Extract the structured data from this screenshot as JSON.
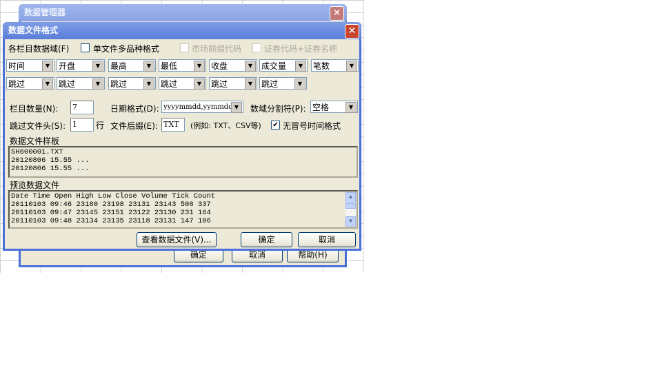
{
  "back_dialog": {
    "title": "数据管理器",
    "ok": "确定",
    "cancel": "取消",
    "help": "帮助(H)",
    "close": "✕"
  },
  "dialog": {
    "title": "数据文件格式",
    "close": "✕",
    "fields_label": "各栏目数据域(F)",
    "multi_label": "单文件多品种格式",
    "market_prefix_label": "市场前缀代码",
    "code_name_label": "证券代码+证券名称",
    "columns_row1": [
      "时间",
      "开盘",
      "最高",
      "最低",
      "收盘",
      "成交量",
      "笔数"
    ],
    "columns_row2": [
      "跳过",
      "跳过",
      "跳过",
      "跳过",
      "跳过",
      "跳过"
    ],
    "count_label": "栏目数量(N):",
    "count_value": "7",
    "date_label": "日期格式(D):",
    "date_value": "yyyymmdd,yymmdd",
    "sep_label": "数域分割符(P):",
    "sep_value": "空格",
    "skip_label": "跳过文件头(S):",
    "skip_value": "1",
    "skip_unit": "行",
    "ext_label": "文件后缀(E):",
    "ext_value": "TXT",
    "ext_hint": "(例如: TXT、CSV等)",
    "nocolon_label": "无冒号时间格式",
    "nocolon_check": "✔",
    "sample_label": "数据文件样板",
    "sample_text": "SH600001.TXT\n20120806 15.55 ...\n20120806 15.55 ...",
    "preview_label": "预览数据文件",
    "preview_text": "Date Time Open High Low Close Volume Tick Count\n20110103 09:46 23180 23198 23131 23143 508 337\n20110103 09:47 23145 23151 23122 23130 231 164\n20110103 09:48 23134 23135 23118 23131 147 106",
    "view_btn": "查看数据文件(V)...",
    "ok": "确定",
    "cancel": "取消",
    "dropdown_arrow": "▼",
    "scroll_up": "▲",
    "scroll_down": "▼"
  }
}
